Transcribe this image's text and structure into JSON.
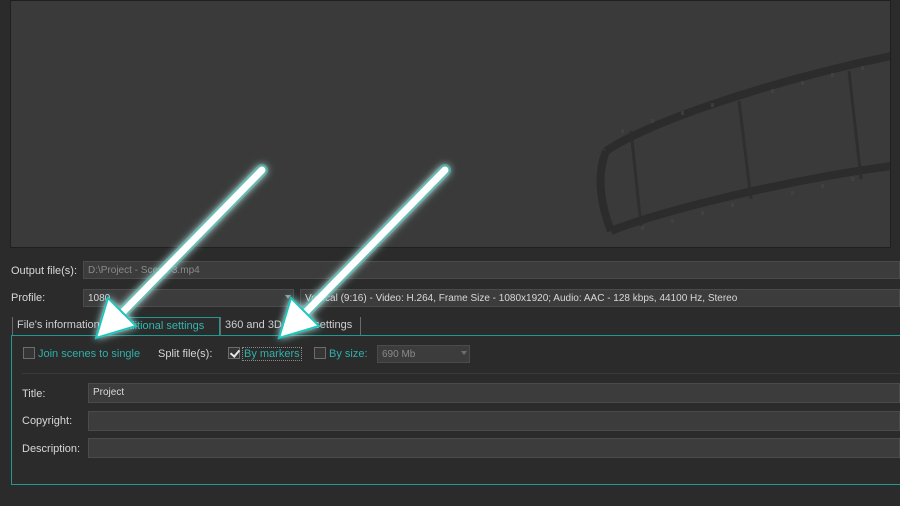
{
  "output": {
    "label": "Output file(s):",
    "value": "D:\\Project - Scene 3.mp4"
  },
  "profile": {
    "label": "Profile:",
    "selected": "1080",
    "description": "Vertical (9:16) - Video: H.264, Frame Size - 1080x1920; Audio: AAC - 128 kbps, 44100 Hz, Stereo"
  },
  "tabs": [
    {
      "label": "File's information"
    },
    {
      "label": "Additional settings"
    },
    {
      "label": "360 and 3D video settings"
    }
  ],
  "options": {
    "join_scenes": {
      "label": "Join scenes to single",
      "checked": false
    },
    "split_label": "Split file(s):",
    "by_markers": {
      "label": "By markers",
      "checked": true
    },
    "by_size": {
      "label": "By size:",
      "checked": false,
      "value": "690 Mb"
    }
  },
  "meta": {
    "title_label": "Title:",
    "title_value": "Project",
    "copyright_label": "Copyright:",
    "copyright_value": "",
    "description_label": "Description:",
    "description_value": ""
  },
  "colors": {
    "accent": "#2fb0a8",
    "arrow": "#ffffff",
    "glow": "#1fc6bd"
  },
  "icons": [
    "film-strip-icon",
    "arrow-pointer-icon",
    "checkmark-icon",
    "chevron-down-icon"
  ]
}
